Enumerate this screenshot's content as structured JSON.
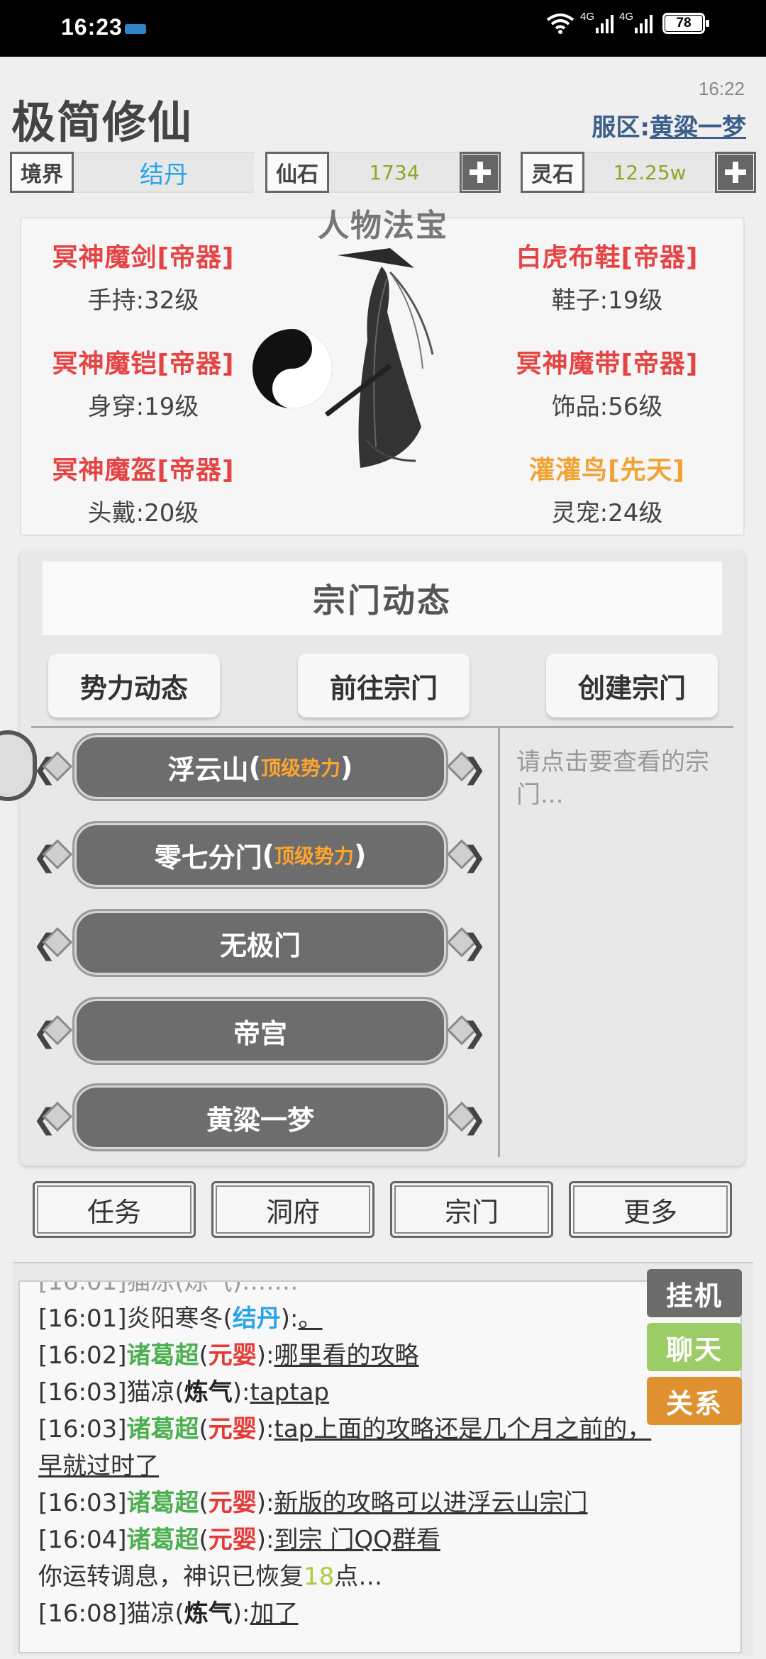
{
  "status_bar": {
    "time": "16:23",
    "battery": "78",
    "net1": "4G",
    "net2": "4G",
    "icons": [
      "nfc-icon",
      "wifi-icon",
      "signal-icon",
      "signal-icon",
      "battery-icon"
    ]
  },
  "header": {
    "title": "极简修仙",
    "clock": "16:22",
    "server_label": "服区:",
    "server_name": "黄粱一梦"
  },
  "resources": {
    "realm_label": "境界",
    "realm_value": "结丹",
    "xianshi_label": "仙石",
    "xianshi_value": "1734",
    "lingshi_label": "灵石",
    "lingshi_value": "12.25w"
  },
  "equipment": {
    "title": "人物法宝",
    "slots": [
      {
        "name": "冥神魔剑[帝器]",
        "level": "手持:32级"
      },
      {
        "name": "冥神魔铠[帝器]",
        "level": "身穿:19级"
      },
      {
        "name": "冥神魔盔[帝器]",
        "level": "头戴:20级"
      },
      {
        "name": "白虎布鞋[帝器]",
        "level": "鞋子:19级"
      },
      {
        "name": "冥神魔带[帝器]",
        "level": "饰品:56级"
      },
      {
        "name": "灌灌鸟[先天]",
        "level": "灵宠:24级"
      }
    ]
  },
  "sect": {
    "title": "宗门动态",
    "tabs": [
      "势力动态",
      "前往宗门",
      "创建宗门"
    ],
    "hint": "请点击要查看的宗门...",
    "list": [
      {
        "name": "浮云山",
        "tag": "顶级势力"
      },
      {
        "name": "零七分门",
        "tag": "顶级势力"
      },
      {
        "name": "无极门",
        "tag": ""
      },
      {
        "name": "帝宫",
        "tag": ""
      },
      {
        "name": "黄粱一梦",
        "tag": ""
      }
    ]
  },
  "nav": [
    "任务",
    "洞府",
    "宗门",
    "更多"
  ],
  "chat": {
    "side_buttons": [
      {
        "label": "挂机",
        "color": "#6c6c6c"
      },
      {
        "label": "聊天",
        "color": "#9ccc65"
      },
      {
        "label": "关系",
        "color": "#e0912f"
      }
    ],
    "messages": [
      {
        "time": "[16:01]",
        "user": "炎阳寒冬",
        "realm": "结丹",
        "text": "。"
      },
      {
        "time": "[16:02]",
        "user": "诸葛超",
        "realm": "元婴",
        "text": "哪里看的攻略"
      },
      {
        "time": "[16:03]",
        "user": "猫凉",
        "realm": "炼气",
        "text": "taptap"
      },
      {
        "time": "[16:03]",
        "user": "诸葛超",
        "realm": "元婴",
        "text": "tap上面的攻略还是几个月之前的，",
        "text2": "早就过时了"
      },
      {
        "time": "[16:03]",
        "user": "诸葛超",
        "realm": "元婴",
        "text": "新版的攻略可以进浮云山宗门"
      },
      {
        "time": "[16:04]",
        "user": "诸葛超",
        "realm": "元婴",
        "text": "到宗 门QQ群看"
      },
      {
        "system_prefix": "你运转调息，神识已恢复",
        "system_num": "18",
        "system_suffix": "点…"
      },
      {
        "time": "[16:08]",
        "user": "猫凉",
        "realm": "炼气",
        "text": "加了"
      }
    ]
  }
}
